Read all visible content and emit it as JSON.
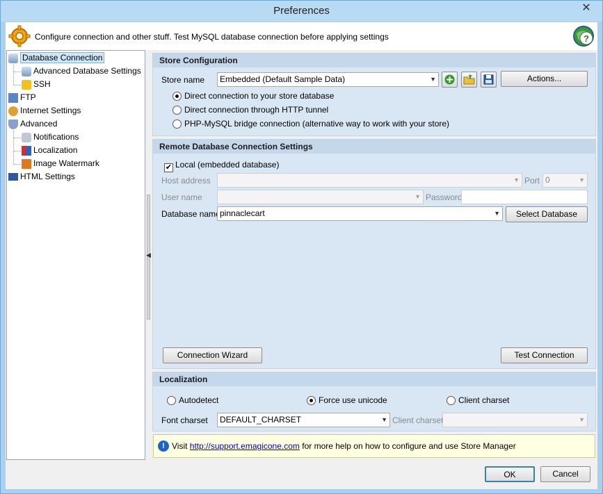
{
  "window": {
    "title": "Preferences",
    "close_glyph": "✕"
  },
  "header": {
    "text": "Configure connection and other stuff. Test MySQL database connection before applying settings",
    "gear_icon": "gear-icon",
    "help_icon": "help-globe-icon"
  },
  "tree": {
    "items": [
      {
        "label": "Database Connection",
        "icon": "database-icon",
        "selected": true
      },
      {
        "label": "Advanced Database Settings",
        "icon": "database-settings-icon"
      },
      {
        "label": "SSH",
        "icon": "lock-icon"
      },
      {
        "label": "FTP",
        "icon": "ftp-icon"
      },
      {
        "label": "Internet Settings",
        "icon": "internet-icon"
      },
      {
        "label": "Advanced",
        "icon": "advanced-shield-icon"
      },
      {
        "label": "Notifications",
        "icon": "notifications-icon"
      },
      {
        "label": "Localization",
        "icon": "localization-icon"
      },
      {
        "label": "Image Watermark",
        "icon": "image-watermark-icon"
      },
      {
        "label": "HTML Settings",
        "icon": "html-icon"
      }
    ]
  },
  "store_config": {
    "heading": "Store Configuration",
    "store_name_label": "Store name",
    "store_name_value": "Embedded (Default Sample Data)",
    "actions_label": "Actions...",
    "radios": [
      {
        "label": "Direct connection to your store database",
        "checked": true
      },
      {
        "label": "Direct connection through HTTP tunnel",
        "checked": false
      },
      {
        "label": "PHP-MySQL bridge connection (alternative way to work with your store)",
        "checked": false
      }
    ]
  },
  "remote": {
    "heading": "Remote Database Connection Settings",
    "local_label": "Local (embedded database)",
    "local_checked": true,
    "host_label": "Host address",
    "port_label": "Port",
    "port_value": "0",
    "user_label": "User name",
    "password_label": "Password",
    "dbname_label": "Database name",
    "dbname_value": "pinnaclecart",
    "select_db_label": "Select Database",
    "wizard_label": "Connection Wizard",
    "test_label": "Test Connection"
  },
  "localization": {
    "heading": "Localization",
    "radios": [
      {
        "label": "Autodetect",
        "checked": false
      },
      {
        "label": "Force use unicode",
        "checked": true
      },
      {
        "label": "Client charset",
        "checked": false
      }
    ],
    "font_charset_label": "Font charset",
    "font_charset_value": "DEFAULT_CHARSET",
    "client_charset_label": "Client charset"
  },
  "info": {
    "prefix": "Visit",
    "link": "http://support.emagicone.com",
    "suffix": "for more help on how to configure and use Store Manager"
  },
  "footer": {
    "ok_label": "OK",
    "cancel_label": "Cancel"
  }
}
